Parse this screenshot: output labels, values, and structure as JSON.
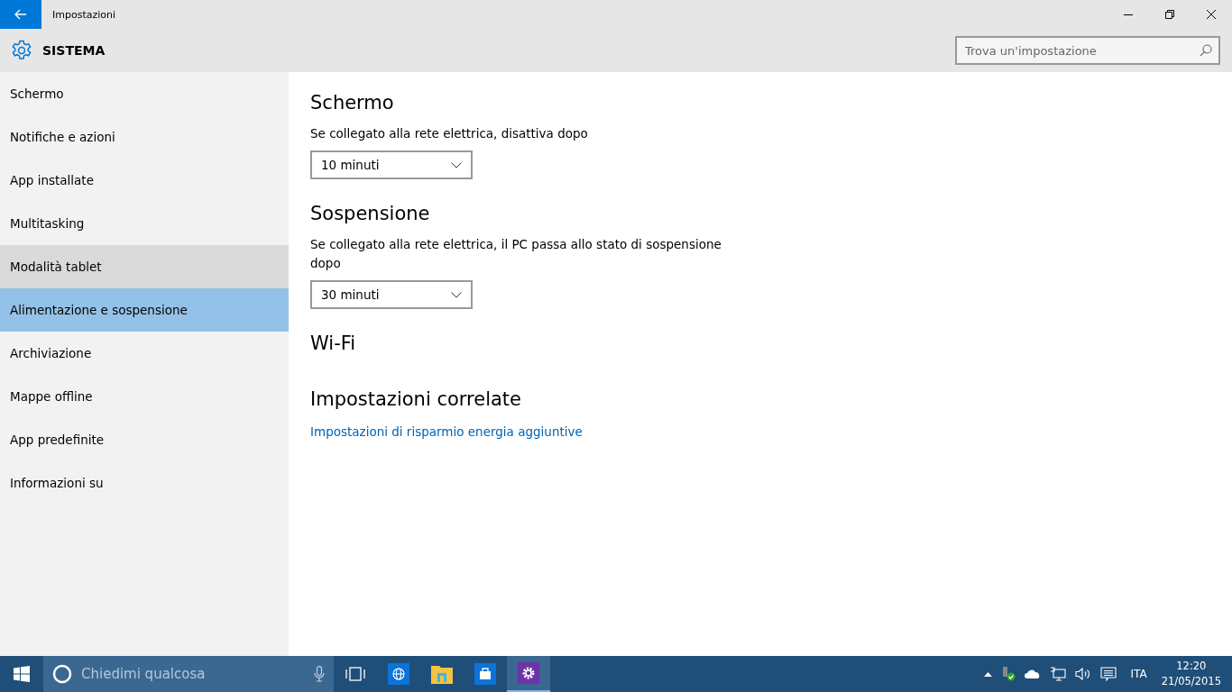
{
  "window": {
    "title": "Impostazioni"
  },
  "header": {
    "title": "SISTEMA",
    "search": {
      "placeholder": "Trova un'impostazione"
    }
  },
  "sidebar": {
    "items": [
      {
        "label": "Schermo",
        "selected": false,
        "hovered": false
      },
      {
        "label": "Notifiche e azioni",
        "selected": false,
        "hovered": false
      },
      {
        "label": "App installate",
        "selected": false,
        "hovered": false
      },
      {
        "label": "Multitasking",
        "selected": false,
        "hovered": false
      },
      {
        "label": "Modalità tablet",
        "selected": false,
        "hovered": true
      },
      {
        "label": "Alimentazione e sospensione",
        "selected": true,
        "hovered": false
      },
      {
        "label": "Archiviazione",
        "selected": false,
        "hovered": false
      },
      {
        "label": "Mappe offline",
        "selected": false,
        "hovered": false
      },
      {
        "label": "App predefinite",
        "selected": false,
        "hovered": false
      },
      {
        "label": "Informazioni su",
        "selected": false,
        "hovered": false
      }
    ]
  },
  "content": {
    "sections": [
      {
        "heading": "Schermo",
        "label": "Se collegato alla rete elettrica, disattiva dopo",
        "value": "10 minuti"
      },
      {
        "heading": "Sospensione",
        "label": "Se collegato alla rete elettrica, il PC passa allo stato di sospensione dopo",
        "value": "30 minuti"
      },
      {
        "heading": "Wi-Fi"
      },
      {
        "heading": "Impostazioni correlate",
        "link": "Impostazioni di risparmio energia aggiuntive"
      }
    ]
  },
  "taskbar": {
    "search": {
      "placeholder": "Chiedimi qualcosa"
    },
    "apps": [
      {
        "kind": "taskview",
        "active": false
      },
      {
        "kind": "browser",
        "active": false
      },
      {
        "kind": "explorer",
        "active": false
      },
      {
        "kind": "store",
        "active": false
      },
      {
        "kind": "settings",
        "active": true
      }
    ],
    "language": "ITA",
    "time": "12:20",
    "date": "21/05/2015"
  }
}
